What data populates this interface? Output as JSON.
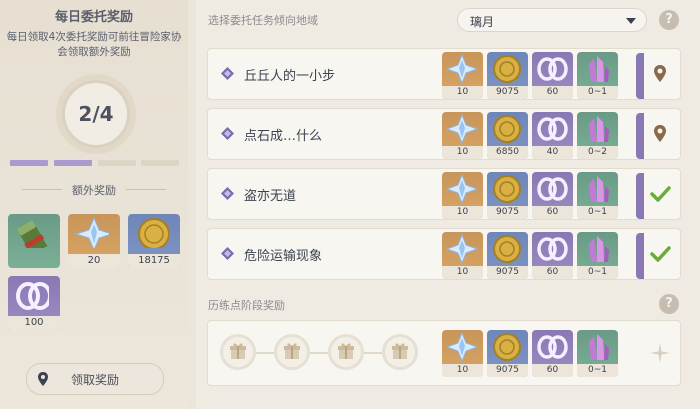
{
  "left": {
    "title": "每日委托奖励",
    "description": "每日领取4次委托奖励可前往冒险家协会领取额外奖励",
    "progress": "2/4",
    "segments_completed": 2,
    "segments_total": 4,
    "extra_rewards_heading": "额外奖励",
    "extra_rewards": [
      {
        "icon": "scroll-icon",
        "count": ""
      },
      {
        "icon": "primogem-icon",
        "count": "20"
      },
      {
        "icon": "mora-icon",
        "count": "18175"
      },
      {
        "icon": "exp-icon",
        "count": "100"
      }
    ],
    "claim_button_label": "领取奖励"
  },
  "header": {
    "region_label": "选择委托任务倾向地域",
    "region_value": "璃月"
  },
  "commissions": [
    {
      "title": "丘丘人的一小步",
      "status": "location",
      "rewards": [
        "10",
        "9075",
        "60",
        "0~1"
      ]
    },
    {
      "title": "点石成…什么",
      "status": "location",
      "rewards": [
        "10",
        "6850",
        "40",
        "0~2"
      ]
    },
    {
      "title": "盗亦无道",
      "status": "completed",
      "rewards": [
        "10",
        "9075",
        "60",
        "0~1"
      ]
    },
    {
      "title": "危险运输现象",
      "status": "completed",
      "rewards": [
        "10",
        "9075",
        "60",
        "0~1"
      ]
    }
  ],
  "milestone": {
    "label": "历练点阶段奖励",
    "gifts": 4,
    "rewards": [
      "10",
      "9075",
      "60",
      "0~1"
    ]
  },
  "colors": {
    "check": "#6aab3a",
    "location_pin": "#8a6a4a",
    "segment_done": "#a99ad0",
    "segment_todo": "#dcd4c5"
  }
}
